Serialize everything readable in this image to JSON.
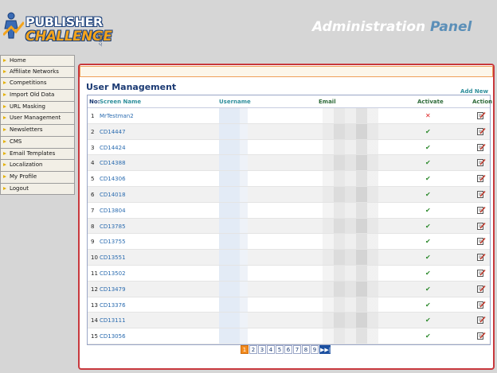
{
  "header": {
    "logo_line1": "PUBLISHER",
    "logo_line2": "CHALLENGE",
    "logo_suffix": ".com",
    "panel_word1": "Administration",
    "panel_word2": "Panel"
  },
  "sidebar": {
    "items": [
      {
        "label": "Home"
      },
      {
        "label": "Affiliate Networks"
      },
      {
        "label": "Competitions"
      },
      {
        "label": "Import Old Data"
      },
      {
        "label": "URL Masking"
      },
      {
        "label": "User Management"
      },
      {
        "label": "Newsletters"
      },
      {
        "label": "CMS"
      },
      {
        "label": "Email Templates"
      },
      {
        "label": "Localization"
      },
      {
        "label": "My Profile"
      },
      {
        "label": "Logout"
      }
    ]
  },
  "main": {
    "title": "User Management",
    "add_new": "Add New",
    "columns": {
      "no": "No:",
      "screen_name": "Screen Name",
      "username": "Username",
      "email": "Email",
      "activate": "Activate",
      "action": "Action"
    },
    "rows": [
      {
        "no": "1",
        "screen_name": "MrTestman2",
        "active": false
      },
      {
        "no": "2",
        "screen_name": "CD14447",
        "active": true
      },
      {
        "no": "3",
        "screen_name": "CD14424",
        "active": true
      },
      {
        "no": "4",
        "screen_name": "CD14388",
        "active": true
      },
      {
        "no": "5",
        "screen_name": "CD14306",
        "active": true
      },
      {
        "no": "6",
        "screen_name": "CD14018",
        "active": true
      },
      {
        "no": "7",
        "screen_name": "CD13804",
        "active": true
      },
      {
        "no": "8",
        "screen_name": "CD13785",
        "active": true
      },
      {
        "no": "9",
        "screen_name": "CD13755",
        "active": true
      },
      {
        "no": "10",
        "screen_name": "CD13551",
        "active": true
      },
      {
        "no": "11",
        "screen_name": "CD13502",
        "active": true
      },
      {
        "no": "12",
        "screen_name": "CD13479",
        "active": true
      },
      {
        "no": "13",
        "screen_name": "CD13376",
        "active": true
      },
      {
        "no": "14",
        "screen_name": "CD13111",
        "active": true
      },
      {
        "no": "15",
        "screen_name": "CD13056",
        "active": true
      }
    ],
    "pagination": {
      "pages": [
        "1",
        "2",
        "3",
        "4",
        "5",
        "6",
        "7",
        "8",
        "9"
      ],
      "current": "1",
      "last_label": "▶▶|"
    }
  },
  "icons": {
    "active": "check-icon",
    "inactive": "cross-icon",
    "edit": "edit-icon"
  },
  "colors": {
    "accent_red": "#c8383d",
    "accent_orange": "#f28a1d",
    "link_blue": "#2b6cb0",
    "title_navy": "#1b3a73"
  }
}
